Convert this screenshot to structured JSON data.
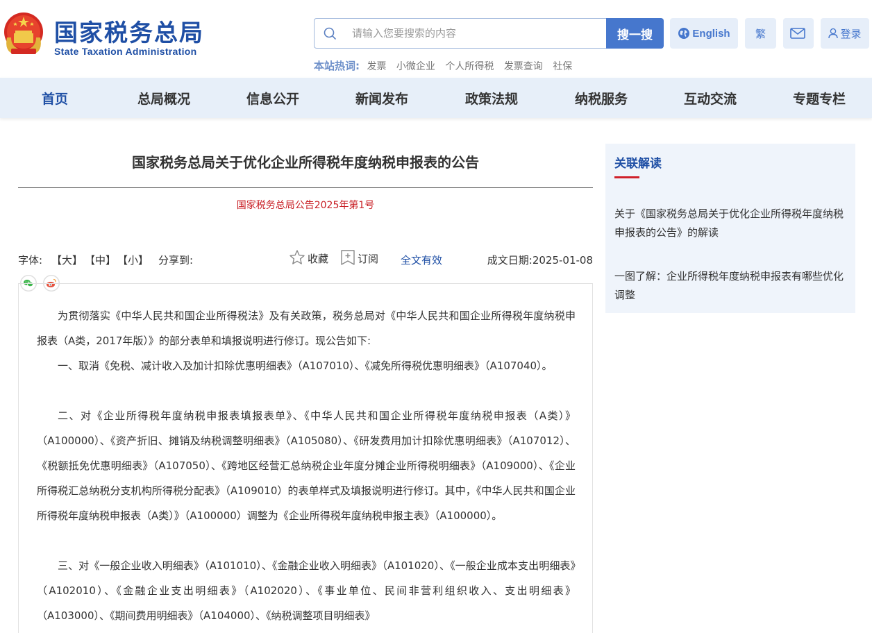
{
  "header": {
    "logo_cn": "国家税务总局",
    "logo_en": "State Taxation Administration",
    "search": {
      "placeholder": "请输入您要搜索的内容",
      "button": "搜一搜"
    },
    "english_label": "English",
    "traditional_label": "繁",
    "login_label": "登录",
    "hotwords_label": "本站热词:",
    "hotwords": [
      "发票",
      "小微企业",
      "个人所得税",
      "发票查询",
      "社保"
    ]
  },
  "nav": {
    "items": [
      "首页",
      "总局概况",
      "信息公开",
      "新闻发布",
      "政策法规",
      "纳税服务",
      "互动交流",
      "专题专栏"
    ],
    "active_index": 0
  },
  "article": {
    "title": "国家税务总局关于优化企业所得税年度纳税申报表的公告",
    "doc_number": "国家税务总局公告2025年第1号",
    "toolbar": {
      "font_label": "字体:",
      "size_large": "【大】",
      "size_medium": "【中】",
      "size_small": "【小】",
      "share_label": "分享到:",
      "favorite": "收藏",
      "subscribe": "订阅",
      "validity": "全文有效",
      "date_label": "成文日期:",
      "date": "2025-01-08"
    },
    "paragraphs": [
      "为贯彻落实《中华人民共和国企业所得税法》及有关政策，税务总局对《中华人民共和国企业所得税年度纳税申报表（A类，2017年版）》的部分表单和填报说明进行修订。现公告如下:",
      "一、取消《免税、减计收入及加计扣除优惠明细表》（A107010）、《减免所得税优惠明细表》（A107040）。",
      "二、对《企业所得税年度纳税申报表填报表单》、《中华人民共和国企业所得税年度纳税申报表（A类）》（A100000）、《资产折旧、摊销及纳税调整明细表》（A105080）、《研发费用加计扣除优惠明细表》（A107012）、《税额抵免优惠明细表》（A107050）、《跨地区经营汇总纳税企业年度分摊企业所得税明细表》（A109000）、《企业所得税汇总纳税分支机构所得税分配表》（A109010）的表单样式及填报说明进行修订。其中，《中华人民共和国企业所得税年度纳税申报表（A类）》（A100000）调整为《企业所得税年度纳税申报主表》（A100000）。",
      "三、对《一般企业收入明细表》（A101010）、《金融企业收入明细表》（A101020）、《一般企业成本支出明细表》（A102010）、《金融企业支出明细表》（A102020）、《事业单位、民间非营利组织收入、支出明细表》（A103000）、《期间费用明细表》（A104000）、《纳税调整项目明细表》"
    ]
  },
  "sidebar": {
    "title": "关联解读",
    "links": [
      "关于《国家税务总局关于优化企业所得税年度纳税申报表的公告》的解读",
      "一图了解：企业所得税年度纳税申报表有哪些优化调整"
    ]
  },
  "colors": {
    "brand_blue": "#1f4fa5",
    "button_blue": "#4677cd",
    "nav_bg": "#e7eff9",
    "accent_red": "#c81d23"
  }
}
